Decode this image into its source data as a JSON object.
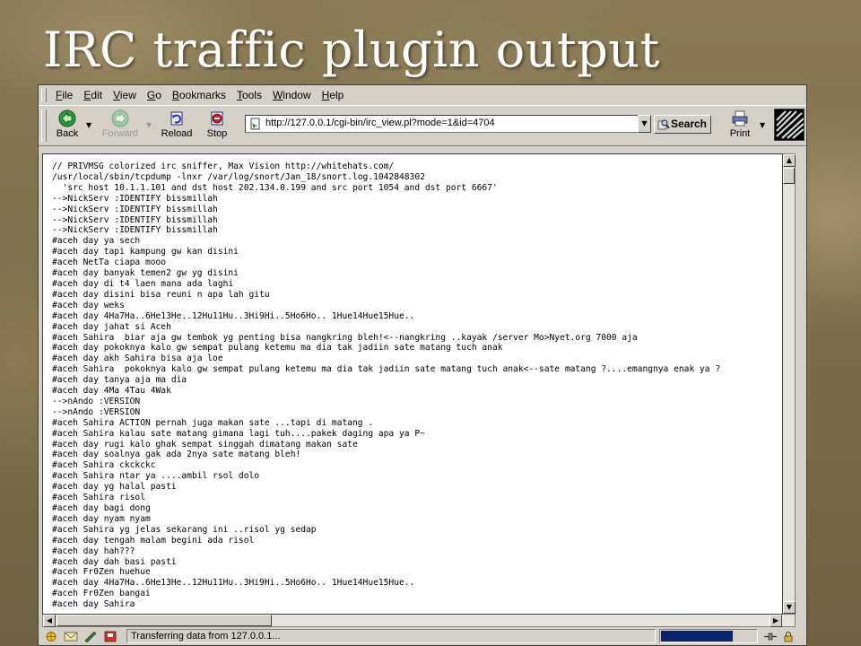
{
  "slide": {
    "title": "IRC traffic plugin output"
  },
  "browser": {
    "menu": [
      "File",
      "Edit",
      "View",
      "Go",
      "Bookmarks",
      "Tools",
      "Window",
      "Help"
    ],
    "toolbar": {
      "back": "Back",
      "forward": "Forward",
      "reload": "Reload",
      "stop": "Stop",
      "search": "Search",
      "print": "Print"
    },
    "url": "http://127.0.0.1/cgi-bin/irc_view.pl?mode=1&id=4704",
    "status_text": "Transferring data from 127.0.0.1...",
    "progress": 0.75,
    "icons": {
      "back": "back-arrow-icon",
      "forward": "forward-arrow-icon",
      "reload": "reload-icon",
      "stop": "stop-icon",
      "print": "printer-icon",
      "search": "search-icon",
      "page": "page-icon",
      "throbber": "mozilla-throbber-icon"
    }
  },
  "content": {
    "lines": [
      "// PRIVMSG colorized irc sniffer, Max Vision http://whitehats.com/",
      "/usr/local/sbin/tcpdump -lnxr /var/log/snort/Jan_18/snort.log.1042848302",
      "  'src host 10.1.1.101 and dst host 202.134.0.199 and src port 1054 and dst port 6667'",
      "-->NickServ :IDENTIFY bissmillah",
      "-->NickServ :IDENTIFY bissmillah",
      "-->NickServ :IDENTIFY bissmillah",
      "-->NickServ :IDENTIFY bissmillah",
      "#aceh day ya sech",
      "#aceh day tapi kampung gw kan disini",
      "#aceh NetTa ciapa mooo",
      "#aceh day banyak temen2 gw yg disini",
      "#aceh day di t4 laen mana ada laghi",
      "#aceh day disini bisa reuni n apa lah gitu",
      "#aceh day weks",
      "#aceh day 4Ha7Ha..6He13He..12Hu11Hu..3Hi9Hi..5Ho6Ho.. 1Hue14Hue15Hue..",
      "#aceh day jahat si Aceh",
      "#aceh Sahira  biar aja gw tembok yg penting bisa nangkring bleh!<--nangkring ..kayak /server Mo>Nyet.org 7000 aja",
      "#aceh day pokoknya kalo gw sempat pulang ketemu ma dia tak jadiin sate matang tuch anak",
      "#aceh day akh Sahira bisa aja loe",
      "#aceh Sahira  pokoknya kalo gw sempat pulang ketemu ma dia tak jadiin sate matang tuch anak<--sate matang ?....emangnya enak ya ?",
      "#aceh day tanya aja ma dia",
      "#aceh day 4Ma 4Tau 4Wak",
      "-->nAndo :VERSION",
      "-->nAndo :VERSION",
      "#aceh Sahira ACTION pernah juga makan sate ...tapi di matang .",
      "#aceh Sahira kalau sate matang gimana lagi tuh....pakek daging apa ya P~",
      "#aceh day rugi kalo ghak sempat singgah dimatang makan sate",
      "#aceh day soalnya gak ada 2nya sate matang bleh!",
      "#aceh Sahira ckckckc",
      "#aceh Sahira ntar ya ....ambil rsol dolo",
      "#aceh day yg halal pasti",
      "#aceh Sahira risol",
      "#aceh day bagi dong",
      "#aceh day nyam nyam",
      "#aceh Sahira yg jelas sekarang ini ..risol yg sedap",
      "#aceh day tengah malam begini ada risol",
      "#aceh day hah???",
      "#aceh day dah basi pasti",
      "#aceh Fr0Zen huehue",
      "#aceh day 4Ha7Ha..6He13He..12Hu11Hu..3Hi9Hi..5Ho6Ho.. 1Hue14Hue15Hue..",
      "#aceh Fr0Zen bangai",
      "#aceh day Sahira"
    ]
  }
}
